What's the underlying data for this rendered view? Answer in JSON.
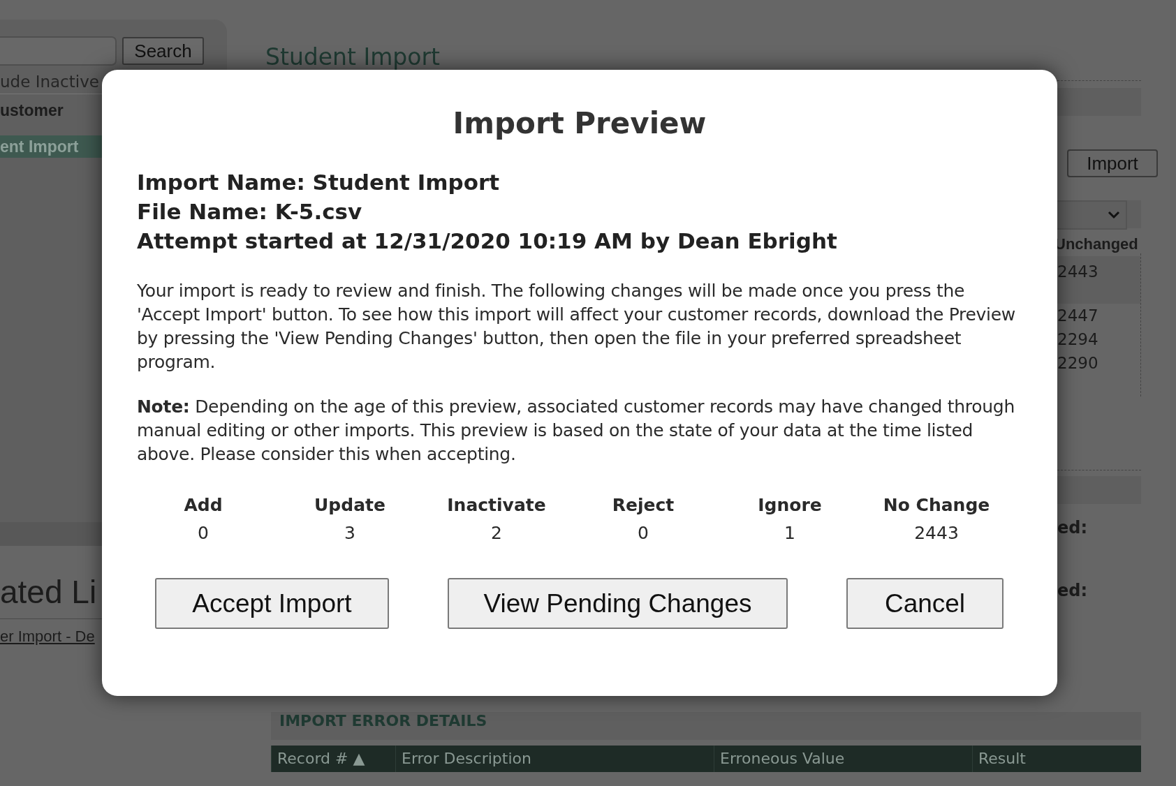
{
  "background": {
    "search_button": "Search",
    "include_inactive": "ude Inactive",
    "customer_label": "ustomer",
    "nav_item": {
      "label": "ent Import",
      "selected": true
    },
    "heading": "ated Li",
    "link": "er Import - De",
    "page_title": "Student Import",
    "import_button": "Import",
    "unchanged_header": "Unchanged",
    "unchanged_values": [
      "2443",
      "2447",
      "2294",
      "2290"
    ],
    "labels": [
      "ed:",
      "ed:"
    ],
    "error_section_title": "IMPORT ERROR DETAILS",
    "error_columns": [
      "Record # ▲",
      "Error Description",
      "Erroneous Value",
      "Result"
    ]
  },
  "dialog": {
    "title": "Import Preview",
    "info_lines": [
      "Import Name: Student Import",
      "File Name: K-5.csv",
      "Attempt started at 12/31/2020 10:19 AM by Dean Ebright"
    ],
    "paragraphs": [
      "Your import is ready to review and finish. The following changes will be made once you press the 'Accept Import' button. To see how this import will affect your customer records, download the Preview by pressing the 'View Pending Changes' button, then open the file in your preferred spreadsheet program.",
      "**Note:** Depending on the age of this preview, associated customer records may have changed through manual editing or other imports. This preview is based on the state of your data at the time listed above. Please consider this when accepting."
    ],
    "stats": [
      {
        "label": "Add",
        "value": "0"
      },
      {
        "label": "Update",
        "value": "3"
      },
      {
        "label": "Inactivate",
        "value": "2"
      },
      {
        "label": "Reject",
        "value": "0"
      },
      {
        "label": "Ignore",
        "value": "1"
      },
      {
        "label": "No Change",
        "value": "2443"
      }
    ],
    "buttons": [
      "Accept Import",
      "View Pending Changes",
      "Cancel"
    ]
  }
}
